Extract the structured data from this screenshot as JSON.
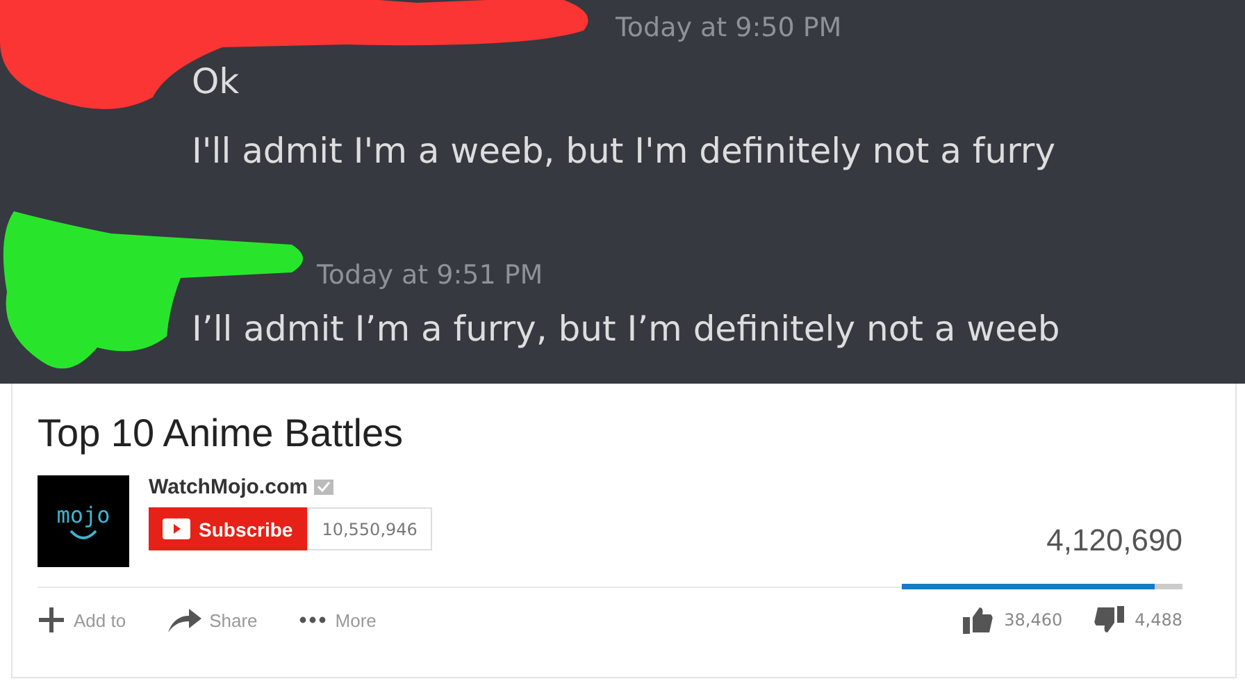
{
  "chat": {
    "messages": [
      {
        "timestamp": "Today at 9:50 PM",
        "lines": [
          "Ok",
          "I'll admit I'm a weeb, but I'm definitely not a furry"
        ]
      },
      {
        "timestamp": "Today at 9:51 PM",
        "lines": [
          "I’ll admit I’m a furry, but I’m definitely not a weeb"
        ]
      }
    ]
  },
  "video": {
    "title": "Top 10 Anime Battles",
    "channel": "WatchMojo.com",
    "avatar_text": "mojo",
    "subscribe": "Subscribe",
    "subscribers": "10,550,946",
    "views": "4,120,690",
    "rating": {
      "level": 0.9,
      "likes": "38,460",
      "dislikes": "4,488"
    },
    "actions": [
      {
        "kind": "add",
        "label": "Add to"
      },
      {
        "kind": "share",
        "label": "Share"
      },
      {
        "kind": "more",
        "label": "More"
      }
    ]
  }
}
